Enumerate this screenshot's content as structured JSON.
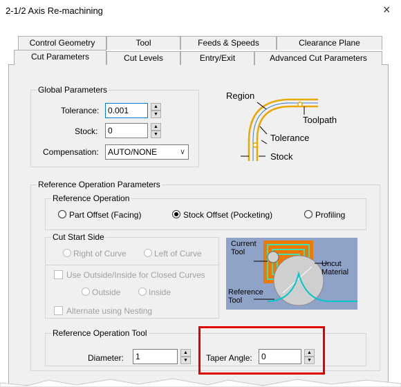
{
  "window": {
    "title": "2-1/2 Axis Re-machining",
    "close_icon": "×"
  },
  "tabs_row_back": [
    "Control Geometry",
    "Tool",
    "Feeds & Speeds",
    "Clearance Plane"
  ],
  "tabs_row_front": [
    "Cut Parameters",
    "Cut Levels",
    "Entry/Exit",
    "Advanced Cut Parameters"
  ],
  "global": {
    "title": "Global Parameters",
    "tolerance_label": "Tolerance:",
    "tolerance_value": "0.001",
    "stock_label": "Stock:",
    "stock_value": "0",
    "compensation_label": "Compensation:",
    "compensation_value": "AUTO/NONE"
  },
  "diagram1": {
    "region": "Region",
    "toolpath": "Toolpath",
    "tolerance": "Tolerance",
    "stock": "Stock"
  },
  "refop": {
    "title": "Reference Operation Parameters",
    "op_group": "Reference Operation",
    "part_offset": "Part Offset (Facing)",
    "stock_offset": "Stock Offset (Pocketing)",
    "profiling": "Profiling",
    "cut_start_title": "Cut Start Side",
    "right_of_curve": "Right of Curve",
    "left_of_curve": "Left of Curve",
    "use_outside_inside": "Use Outside/Inside for Closed Curves",
    "outside": "Outside",
    "inside": "Inside",
    "alternate_nesting": "Alternate using Nesting"
  },
  "diagram2": {
    "current_tool": "Current\nTool",
    "uncut_material": "Uncut\nMaterial",
    "reference_tool": "Reference\nTool"
  },
  "reftool": {
    "title": "Reference Operation Tool",
    "diameter_label": "Diameter:",
    "diameter_value": "1",
    "taper_label": "Taper Angle:",
    "taper_value": "0"
  },
  "colors": {
    "highlight": "#e00000",
    "toolpath": "#e8a800",
    "stock_line": "#3a7bd5",
    "diagram2_bg": "#8fa3c8",
    "material": "#f07800",
    "ref_curve": "#00c8c8"
  }
}
